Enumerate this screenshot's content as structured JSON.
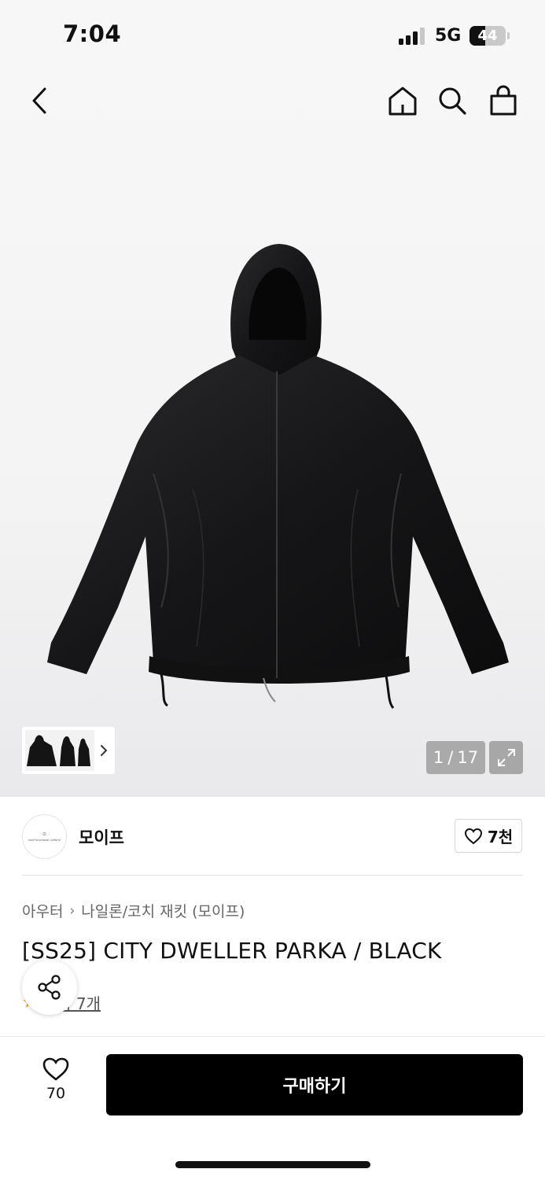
{
  "status_bar": {
    "time": "7:04",
    "network": "5G",
    "battery": "44",
    "battery_level": 0.44
  },
  "header": {
    "back_icon": "chevron-left-icon",
    "home_icon": "home-icon",
    "search_icon": "search-icon",
    "cart_icon": "shopping-bag-icon"
  },
  "gallery": {
    "current": "1",
    "separator": "/",
    "total": "17",
    "expand_icon": "expand-icon",
    "thumb_chevron_icon": "chevron-right-icon"
  },
  "brand": {
    "logo_mark": "⊙",
    "logo_text": "moif functional uniform",
    "name": "모이프",
    "like_count": "7천",
    "like_icon": "heart-outline-icon"
  },
  "product": {
    "breadcrumb": [
      "아우터",
      "나일론/코치 재킷 (모이프)"
    ],
    "title": "[SS25] CITY DWELLER PARKA / BLACK",
    "review_prefix": "★",
    "review_text": "후기 7개",
    "share_icon": "share-icon"
  },
  "bottom_bar": {
    "wish_count": "70",
    "wish_icon": "heart-outline-icon",
    "buy_label": "구매하기"
  },
  "colors": {
    "buy_button": "#000000",
    "star": "#f5a623",
    "counter_bg": "#a7a7a7"
  }
}
